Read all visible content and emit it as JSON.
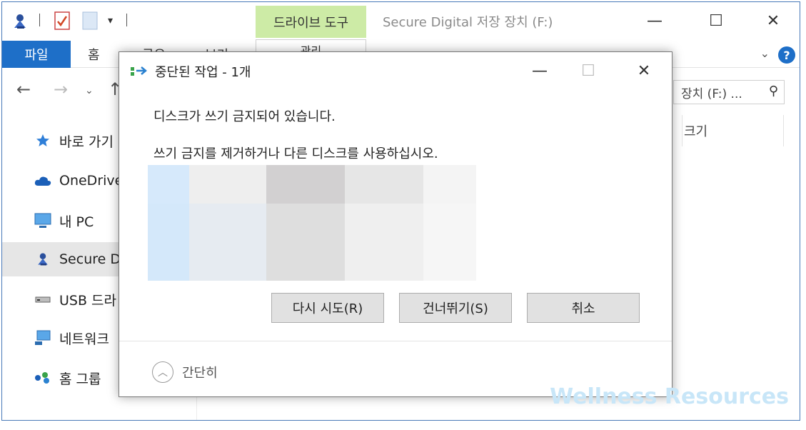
{
  "explorer": {
    "context_tab": "드라이브 도구",
    "window_title": "Secure Digital 저장 장치 (F:)",
    "tabs": [
      "파일",
      "홈",
      "공유",
      "보기"
    ],
    "manage_tab": "관리",
    "search_text": "장치 (F:) ...",
    "column_size": "크기",
    "nav": [
      {
        "label": "바로 가기",
        "icon": "star-icon"
      },
      {
        "label": "OneDrive",
        "icon": "cloud-icon"
      },
      {
        "label": "내 PC",
        "icon": "computer-icon"
      },
      {
        "label": "Secure D",
        "icon": "usb-drive-icon"
      },
      {
        "label": "USB 드라",
        "icon": "drive-icon"
      },
      {
        "label": "네트워크",
        "icon": "network-icon"
      },
      {
        "label": "홈 그룹",
        "icon": "homegroup-icon"
      }
    ]
  },
  "dialog": {
    "title": "중단된 작업 - 1개",
    "message": "디스크가 쓰기 금지되어 있습니다.",
    "instruction": "쓰기 금지를 제거하거나 다른 디스크를 사용하십시오.",
    "buttons": {
      "retry": "다시 시도(R)",
      "skip": "건너뛰기(S)",
      "cancel": "취소"
    },
    "collapse_label": "간단히"
  },
  "watermark": "Wellness Resources",
  "colors": {
    "accent": "#1e6fc8",
    "context_tab": "#cdeba6",
    "button_face": "#e1e1e1"
  }
}
